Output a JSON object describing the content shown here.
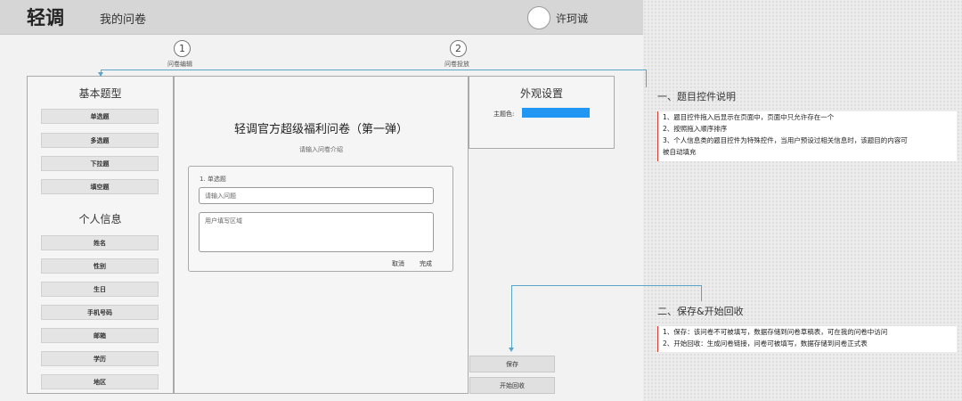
{
  "header": {
    "logo": "轻调",
    "nav_my_surveys": "我的问卷",
    "user_name": "许珂诚"
  },
  "steps": [
    {
      "number": "1",
      "label": "问卷编辑"
    },
    {
      "number": "2",
      "label": "问卷投放"
    }
  ],
  "left_panel": {
    "basic_title": "基本题型",
    "basic_items": [
      "单选题",
      "多选题",
      "下拉题",
      "填空题"
    ],
    "personal_title": "个人信息",
    "personal_items": [
      "姓名",
      "性别",
      "生日",
      "手机号码",
      "邮箱",
      "学历",
      "地区"
    ]
  },
  "editor": {
    "survey_title": "轻调官方超级福利问卷（第一弹）",
    "intro_placeholder": "请输入问卷介绍",
    "question_type": "1. 单选题",
    "question_placeholder": "请输入问题",
    "answer_placeholder": "用户填写区域",
    "cancel": "取消",
    "done": "完成"
  },
  "appearance": {
    "title": "外观设置",
    "theme_label": "主题色:",
    "theme_color": "#2196f3"
  },
  "actions": {
    "save": "保存",
    "start_collect": "开始回收"
  },
  "annotations": {
    "section1_title": "一、题目控件说明",
    "section1_lines": [
      "1、题目控件拖入后显示在页面中，页面中只允许存在一个",
      "2、按照拖入顺序排序",
      "3、个人信息类的题目控件为特殊控件，当用户预设过相关信息时，该题目的内容可",
      "被自动填充"
    ],
    "section2_title": "二、保存&开始回收",
    "section2_lines": [
      "1、保存：该问卷不可被填写，数据存储到问卷草稿表，可在我的问卷中访问",
      "2、开始回收：生成问卷链接，问卷可被填写，数据存储到问卷正式表"
    ]
  },
  "colors": {
    "accent_line": "#5aa6c8",
    "annotation_border": "#d0392b"
  }
}
